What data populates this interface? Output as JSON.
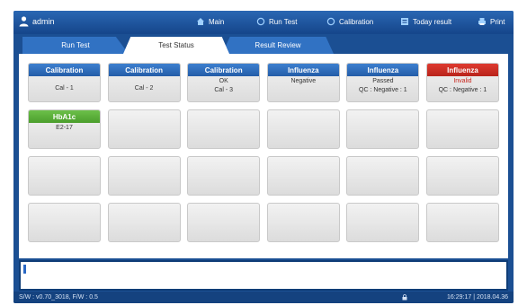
{
  "topbar": {
    "user": "admin",
    "nav": [
      {
        "label": "Main",
        "icon": "home-icon"
      },
      {
        "label": "Run Test",
        "icon": "run-test-icon"
      },
      {
        "label": "Calibration",
        "icon": "calibration-icon"
      },
      {
        "label": "Today result",
        "icon": "list-icon"
      },
      {
        "label": "Print",
        "icon": "printer-icon"
      }
    ]
  },
  "tabs": [
    "Run Test",
    "Test Status",
    "Result Review"
  ],
  "cells": [
    {
      "header": "Calibration",
      "color": "blue",
      "lines": [
        "Cal - 1"
      ]
    },
    {
      "header": "Calibration",
      "color": "blue",
      "lines": [
        "Cal - 2"
      ]
    },
    {
      "header": "Calibration",
      "color": "blue",
      "lines": [
        "OK",
        "Cal - 3"
      ]
    },
    {
      "header": "Influenza",
      "color": "blue",
      "lines": [
        "Negative"
      ]
    },
    {
      "header": "Influenza",
      "color": "blue",
      "lines": [
        "Passed",
        "QC : Negative : 1"
      ]
    },
    {
      "header": "Influenza",
      "color": "red",
      "lines": [
        "Invalid",
        "QC : Negative : 1"
      ]
    },
    {
      "header": "HbA1c",
      "color": "green",
      "lines": [
        "E2-17"
      ]
    }
  ],
  "status": {
    "version": "S/W : v0.70_3018, F/W : 0.5",
    "datetime": "16:29:17 | 2018.04.36"
  },
  "colors": {
    "blue": "#2f6cbd",
    "red": "#c8261d",
    "green": "#5db13b",
    "frame": "#1b4f93"
  }
}
